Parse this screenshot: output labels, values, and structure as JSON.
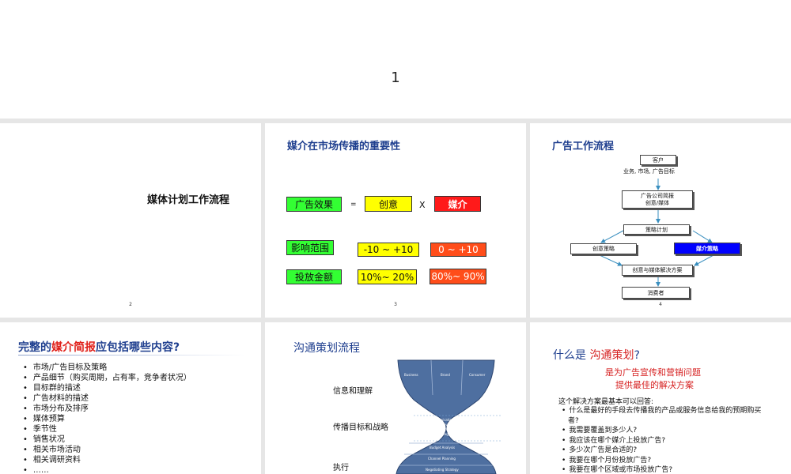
{
  "slide1": {
    "number": "1"
  },
  "slide2": {
    "title": "媒体计划工作流程",
    "page": "2"
  },
  "slide3": {
    "title": "媒介在市场传播的重要性",
    "row1": {
      "a": "广告效果",
      "eq": "=",
      "b": "创意",
      "x": "X",
      "c": "媒介"
    },
    "row2": {
      "label": "影响范围",
      "b": "-10 ~ +10",
      "c": "0 ~ +10"
    },
    "row3": {
      "label": "投放金额",
      "b": "10%~ 20%",
      "c": "80%~ 90%"
    },
    "colors": {
      "green": "#33ff33",
      "yellow": "#ffff00",
      "red": "#ff1a1a",
      "orange": "#ff4d1a"
    },
    "page": "3"
  },
  "slide4": {
    "title": "广告工作流程",
    "client": "客户",
    "client_sub": "业务, 市场, 广告目标",
    "agency_l1": "广告公司简报",
    "agency_l2": "创意/媒体",
    "strategy": "策略计划",
    "creative": "创意策略",
    "media": "媒介策略",
    "solution": "创意与媒体解决方案",
    "consumer": "消费者",
    "page": "4"
  },
  "slide5": {
    "title_pre": "完整的",
    "title_hl": "媒介简报",
    "title_post": "应包括哪些内容?",
    "items": [
      "市场/广告目标及策略",
      "产品细节（购买周期，占有率，竞争者状况）",
      "目标群的描述",
      "广告材料的描述",
      "市场分布及排序",
      "媒体预算",
      "季节性",
      "销售状况",
      "相关市场活动",
      "相关调研资料",
      "……"
    ]
  },
  "slide6": {
    "title": "沟通策划流程",
    "label1": "信息和理解",
    "label2": "传播目标和战略",
    "label3": "执行",
    "top_cols": [
      "Business",
      "Brand",
      "Consumer"
    ],
    "mid1": "Communications",
    "mid2": "Objectives",
    "mid3": "and",
    "mid4": "Strategy",
    "band1": "Budget Analysis",
    "band2": "Channel Planning",
    "band3": "Negotiating Strategy"
  },
  "slide7": {
    "title_pre": "什么是 ",
    "title_hl": "沟通策划",
    "title_post": "?",
    "sub1": "是为广告宣传和营销问题",
    "sub2": "提供最佳的解决方案",
    "intro": "这个解决方案最基本可以回答:",
    "items": [
      "什么是最好的手段去传播我的产品或服务信息给我的预期购买者?",
      "我需要覆盖到多少人?",
      "我应该在哪个媒介上投放广告?",
      "多少次广告是合适的?",
      "我要在哪个月份投放广告?",
      "我要在哪个区域或市场投放广告?"
    ]
  }
}
